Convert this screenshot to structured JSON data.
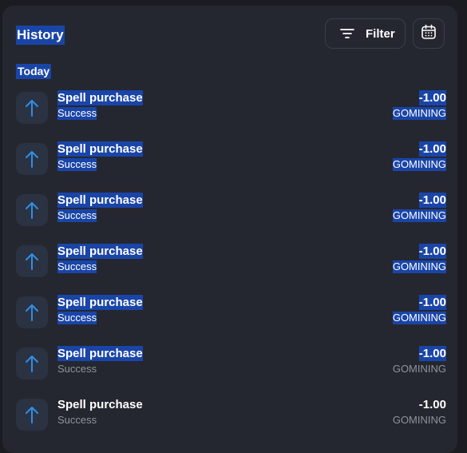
{
  "header": {
    "title": "History",
    "filter_label": "Filter",
    "filter_icon": "filter-lines-icon",
    "calendar_icon": "calendar-icon"
  },
  "sections": [
    {
      "label": "Today",
      "items": [
        {
          "name": "Spell purchase",
          "status": "Success",
          "amount": "-1.00",
          "currency": "GOMINING"
        },
        {
          "name": "Spell purchase",
          "status": "Success",
          "amount": "-1.00",
          "currency": "GOMINING"
        },
        {
          "name": "Spell purchase",
          "status": "Success",
          "amount": "-1.00",
          "currency": "GOMINING"
        },
        {
          "name": "Spell purchase",
          "status": "Success",
          "amount": "-1.00",
          "currency": "GOMINING"
        },
        {
          "name": "Spell purchase",
          "status": "Success",
          "amount": "-1.00",
          "currency": "GOMINING"
        },
        {
          "name": "Spell purchase",
          "status": "Success",
          "amount": "-1.00",
          "currency": "GOMINING"
        },
        {
          "name": "Spell purchase",
          "status": "Success",
          "amount": "-1.00",
          "currency": "GOMINING"
        }
      ]
    }
  ],
  "colors": {
    "background": "#1b1c21",
    "panel": "#252730",
    "selection": "#1a45a8",
    "arrow": "#2f8fe8",
    "muted_text": "#8f929c"
  }
}
